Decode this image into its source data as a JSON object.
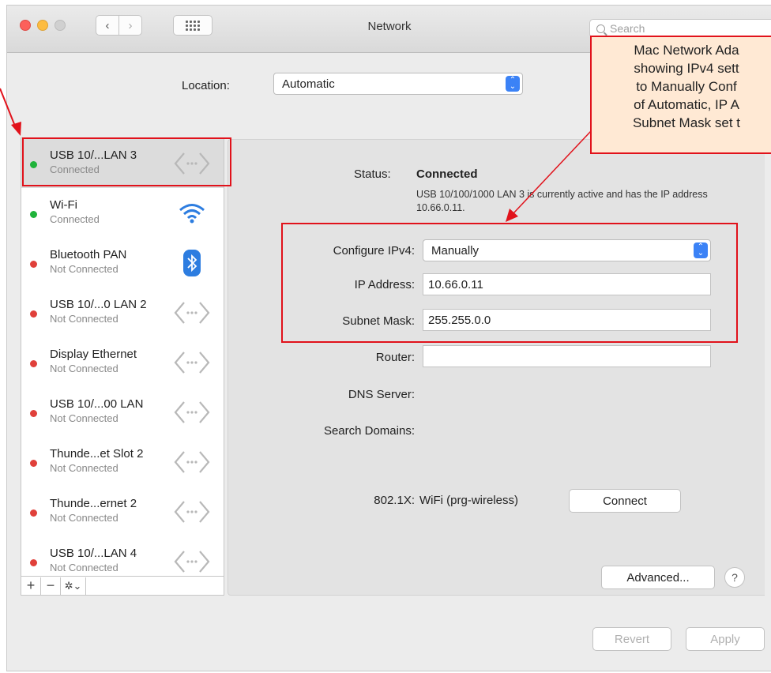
{
  "window": {
    "title": "Network",
    "search_placeholder": "Search",
    "back_label": "‹",
    "forward_label": "›"
  },
  "location": {
    "label": "Location:",
    "value": "Automatic"
  },
  "services": [
    {
      "name": "USB 10/...LAN 3",
      "status": "Connected",
      "dot": "green",
      "icon": "ethernet-icon",
      "selected": true
    },
    {
      "name": "Wi-Fi",
      "status": "Connected",
      "dot": "green",
      "icon": "wifi-icon"
    },
    {
      "name": "Bluetooth PAN",
      "status": "Not Connected",
      "dot": "red",
      "icon": "bluetooth-icon"
    },
    {
      "name": "USB 10/...0 LAN 2",
      "status": "Not Connected",
      "dot": "red",
      "icon": "ethernet-icon"
    },
    {
      "name": "Display Ethernet",
      "status": "Not Connected",
      "dot": "red",
      "icon": "ethernet-icon"
    },
    {
      "name": "USB 10/...00 LAN",
      "status": "Not Connected",
      "dot": "red",
      "icon": "ethernet-icon"
    },
    {
      "name": "Thunde...et Slot 2",
      "status": "Not Connected",
      "dot": "red",
      "icon": "ethernet-icon"
    },
    {
      "name": "Thunde...ernet 2",
      "status": "Not Connected",
      "dot": "red",
      "icon": "ethernet-icon"
    },
    {
      "name": "USB 10/...LAN 4",
      "status": "Not Connected",
      "dot": "red",
      "icon": "ethernet-icon"
    }
  ],
  "sidebar_controls": {
    "add": "+",
    "remove": "−",
    "gear": "✲⌄"
  },
  "detail": {
    "status_label": "Status:",
    "status_value": "Connected",
    "status_description": "USB 10/100/1000 LAN 3 is currently active and has the IP address 10.66.0.11.",
    "configure_label": "Configure IPv4:",
    "configure_value": "Manually",
    "ip_label": "IP Address:",
    "ip_value": "10.66.0.11",
    "mask_label": "Subnet Mask:",
    "mask_value": "255.255.0.0",
    "router_label": "Router:",
    "router_value": "",
    "dns_label": "DNS Server:",
    "search_domains_label": "Search Domains:",
    "dot1x_label": "802.1X:",
    "dot1x_value": "WiFi (prg-wireless)",
    "connect_button": "Connect",
    "advanced_button": "Advanced...",
    "help_button": "?",
    "revert_button": "Revert",
    "apply_button": "Apply"
  },
  "annotation": {
    "lines": [
      "Mac Network Ada",
      "showing IPv4 sett",
      "to Manually Conf",
      "of Automatic, IP A",
      "Subnet Mask set t"
    ]
  },
  "colors": {
    "annotation_red": "#e1121b",
    "callout_bg": "#ffe9d4",
    "connected_green": "#1fb33a",
    "disconnected_red": "#e0403a",
    "accent_blue": "#3b82f6"
  }
}
